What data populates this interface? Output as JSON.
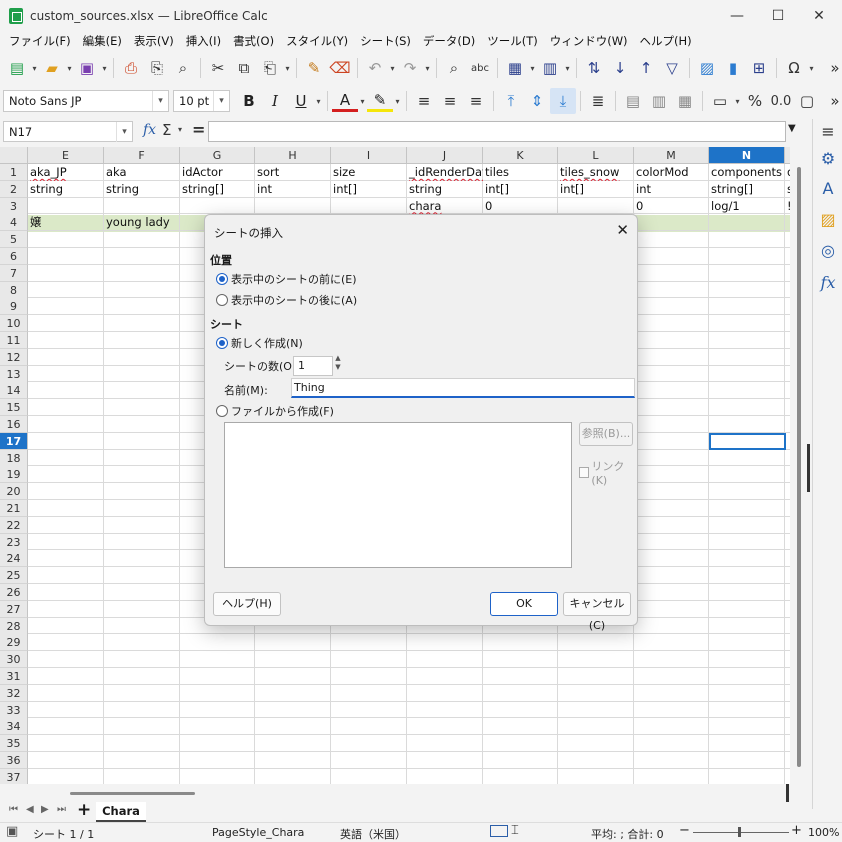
{
  "window": {
    "title": "custom_sources.xlsx — LibreOffice Calc",
    "minimize": "—",
    "maximize": "☐",
    "close": "✕"
  },
  "menu": [
    "ファイル(F)",
    "編集(E)",
    "表示(V)",
    "挿入(I)",
    "書式(O)",
    "スタイル(Y)",
    "シート(S)",
    "データ(D)",
    "ツール(T)",
    "ウィンドウ(W)",
    "ヘルプ(H)"
  ],
  "format_toolbar": {
    "font_name": "Noto Sans JP",
    "font_size": "10 pt"
  },
  "formula_bar": {
    "cell_ref": "N17",
    "fx": "fx",
    "sum": "Σ",
    "equals": "=",
    "content": ""
  },
  "grid": {
    "columns": [
      "E",
      "F",
      "G",
      "H",
      "I",
      "J",
      "K",
      "L",
      "M",
      "N",
      "O"
    ],
    "selected_column": "N",
    "selected_row": "17",
    "rows": [
      "1",
      "2",
      "3",
      "4",
      "5",
      "6",
      "7",
      "8",
      "9",
      "10",
      "11",
      "12",
      "13",
      "14",
      "15",
      "16",
      "17",
      "18",
      "19",
      "20",
      "21",
      "22",
      "23",
      "24",
      "25",
      "26",
      "27",
      "28",
      "29",
      "30",
      "31",
      "32",
      "33",
      "34",
      "35",
      "36",
      "37"
    ],
    "row1": [
      "aka_JP",
      "aka",
      "idActor",
      "sort",
      "size",
      "_idRenderDat",
      "tiles",
      "tiles_snow",
      "colorMod",
      "components",
      "d"
    ],
    "row2": [
      "string",
      "string",
      "string[]",
      "int",
      "int[]",
      "string",
      "int[]",
      "int[]",
      "int",
      "string[]",
      "s"
    ],
    "row3": [
      "",
      "",
      "",
      "",
      "",
      "chara",
      "0",
      "",
      "0",
      "log/1",
      "!"
    ],
    "row4": [
      "嬢",
      "young lady",
      "",
      "",
      "",
      "",
      "",
      "",
      "",
      "",
      ""
    ]
  },
  "dialog": {
    "title": "シートの挿入",
    "section_position": "位置",
    "radio_before": "表示中のシートの前に(E)",
    "radio_after": "表示中のシートの後に(A)",
    "section_sheet": "シート",
    "radio_new": "新しく作成(N)",
    "count_label": "シートの数(O):",
    "count_value": "1",
    "name_label": "名前(M):",
    "name_value": "Thing",
    "radio_from_file": "ファイルから作成(F)",
    "browse_button": "参照(B)...",
    "link_checkbox": "リンク(K)",
    "help_button": "ヘルプ(H)",
    "ok_button": "OK",
    "cancel_button": "キャンセル(C)"
  },
  "tabs": {
    "add": "+",
    "sheet": "Chara"
  },
  "status": {
    "sheet_pos": "シート 1 / 1",
    "page_style": "PageStyle_Chara",
    "language": "英語（米国）",
    "summary": "平均: ; 合計: 0",
    "zoom_minus": "−",
    "zoom_plus": "+",
    "zoom": "100%"
  }
}
